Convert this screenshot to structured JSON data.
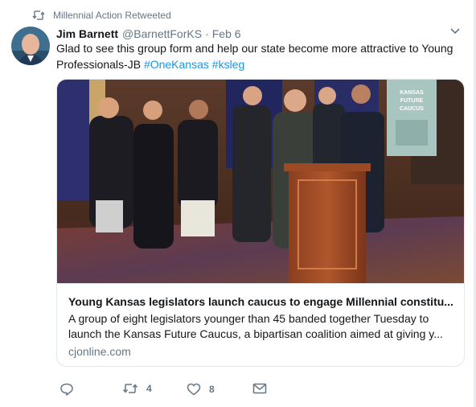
{
  "retweet_notice": "Millennial Action Retweeted",
  "tweet": {
    "author_name": "Jim Barnett",
    "author_handle": "@BarnettForKS",
    "separator": "·",
    "date": "Feb 6",
    "text_prefix": "Glad to see this group form and help our state become more attractive to Young Professionals-JB ",
    "hashtag_1": "#OneKansas",
    "hashtag_2": "#ksleg"
  },
  "card": {
    "title": "Young Kansas legislators launch caucus to engage Millennial constitu...",
    "description_line1": "A group of eight legislators younger than 45 banded together Tuesday to",
    "description_line2": "launch the Kansas Future Caucus, a bipartisan coalition aimed at giving y...",
    "domain": "cjonline.com",
    "sign_text": [
      "KANSAS",
      "FUTURE",
      "CAUCUS"
    ]
  },
  "actions": {
    "reply_count": "",
    "retweet_count": "4",
    "like_count": "8"
  },
  "colors": {
    "link": "#1b95e0",
    "muted": "#657786",
    "text": "#14171a",
    "border": "#e1e8ed"
  }
}
